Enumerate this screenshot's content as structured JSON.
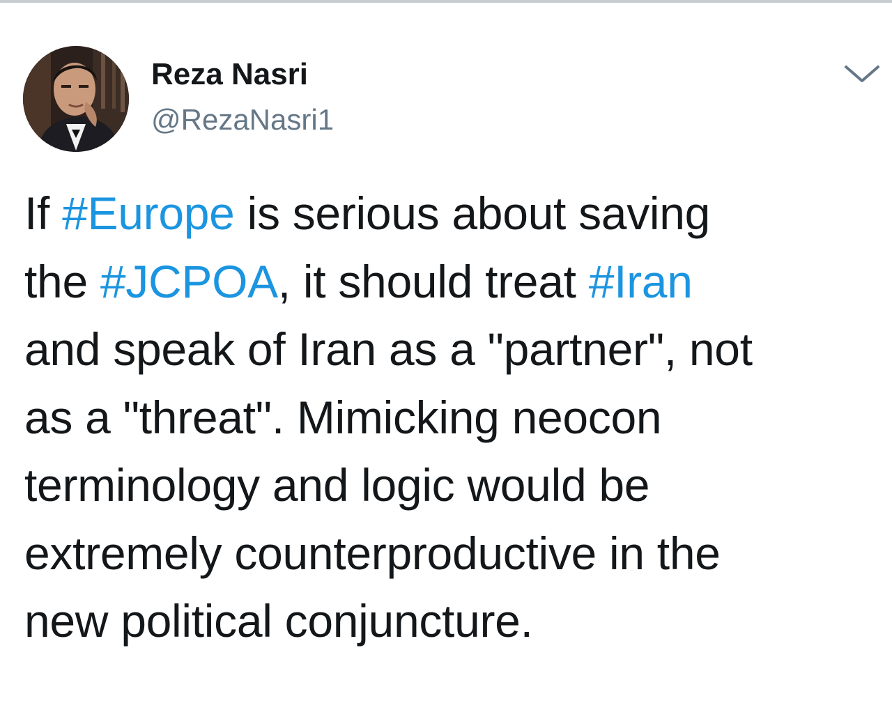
{
  "colors": {
    "text": "#14171a",
    "handle": "#657786",
    "hashtag": "#1b95e0",
    "chevron": "#657786",
    "top_rule": "#c8cdd1"
  },
  "author": {
    "display_name": "Reza Nasri",
    "handle": "@RezaNasri1"
  },
  "menu": {
    "icon": "chevron-down-icon"
  },
  "tweet": {
    "lines": [
      {
        "t1": "If ",
        "h1": "#Europe",
        "t2": " is serious about saving"
      },
      {
        "t1": "the ",
        "h1": "#JCPOA",
        "t2": ", it should treat ",
        "h2": "#Iran"
      },
      {
        "t1": "and speak of Iran as a \"partner\", not"
      },
      {
        "t1": "as a \"threat\". Mimicking neocon"
      },
      {
        "t1": "terminology and logic would be"
      },
      {
        "t1": "extremely counterproductive in the"
      },
      {
        "t1": "new political conjuncture."
      }
    ]
  }
}
